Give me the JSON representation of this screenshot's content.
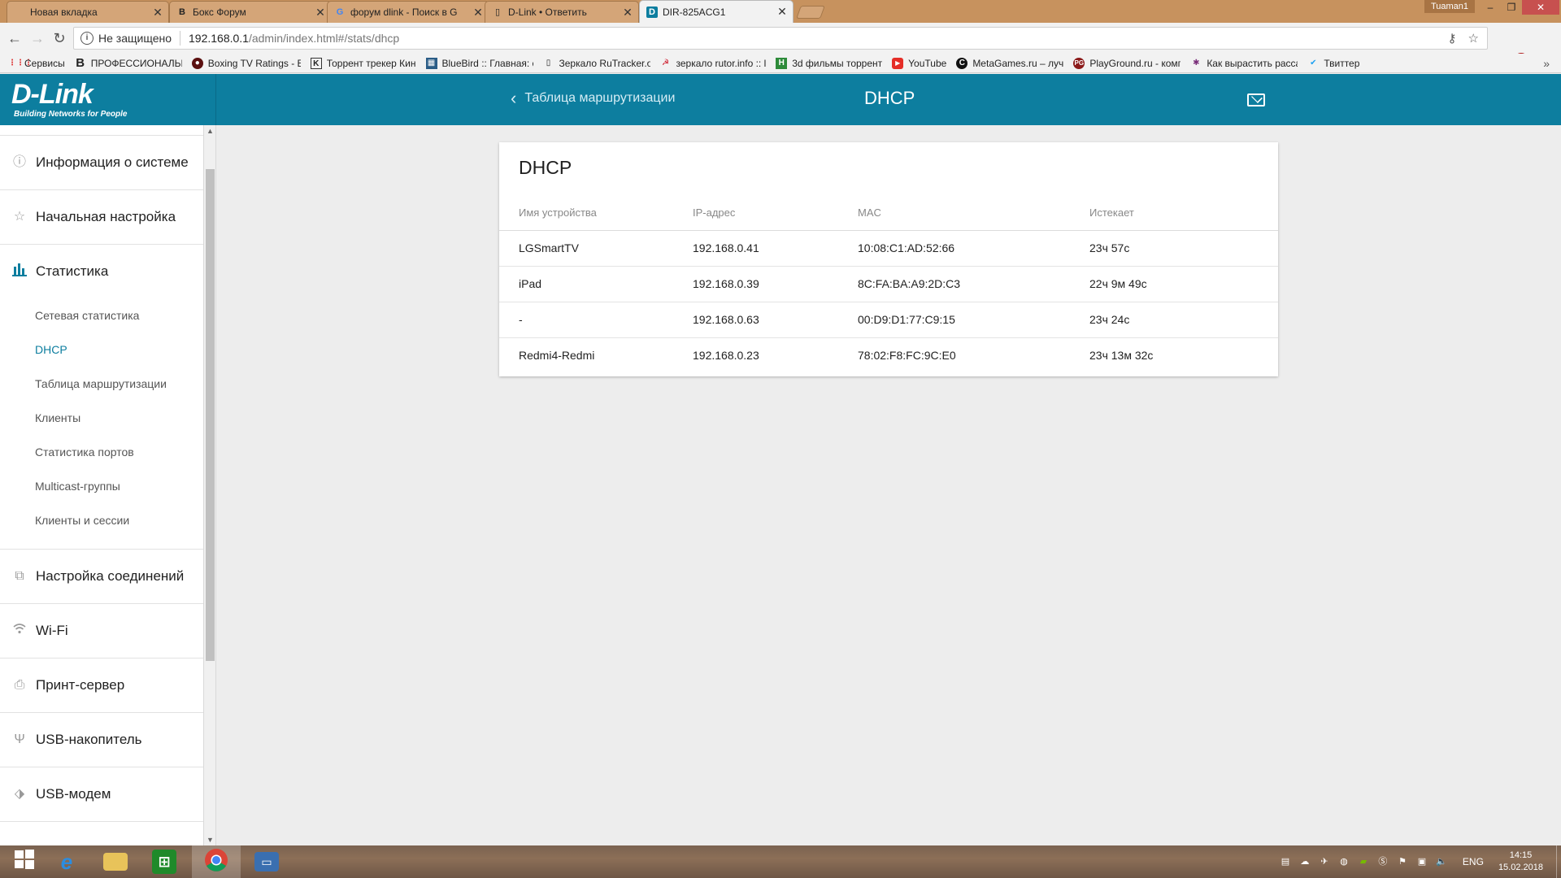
{
  "browser": {
    "tabs": [
      {
        "title": "Новая вкладка",
        "favicon": "blank-page-icon",
        "active": false
      },
      {
        "title": "Бокс Форум",
        "favicon": "vk-b-icon",
        "active": false
      },
      {
        "title": "форум dlink - Поиск в G",
        "favicon": "google-g-icon",
        "active": false
      },
      {
        "title": "D-Link • Ответить",
        "favicon": "page-icon",
        "active": false
      },
      {
        "title": "DIR-825ACG1",
        "favicon": "dlink-d-icon",
        "active": true
      }
    ],
    "user_badge": "Tuaman1",
    "security_label": "Не защищено",
    "url_host": "192.168.0.1",
    "url_path": "/admin/index.html#/stats/dhcp",
    "bookmarks": [
      {
        "label": "Сервисы",
        "icon": "apps-grid-icon"
      },
      {
        "label": "ПРОФЕССИОНАЛЬН",
        "icon": "b-logo-icon"
      },
      {
        "label": "Boxing TV Ratings - E",
        "icon": "boxing-icon"
      },
      {
        "label": "Торрент трекер Кин",
        "icon": "k-logo-icon"
      },
      {
        "label": "BlueBird :: Главная: с",
        "icon": "bluebird-icon"
      },
      {
        "label": "Зеркало RuTracker.o",
        "icon": "page-icon"
      },
      {
        "label": "зеркало rutor.info :: l",
        "icon": "rutor-icon"
      },
      {
        "label": "3d фильмы торрент",
        "icon": "h-logo-icon"
      },
      {
        "label": "YouTube",
        "icon": "youtube-icon"
      },
      {
        "label": "MetaGames.ru – лучш",
        "icon": "metagames-icon"
      },
      {
        "label": "PlayGround.ru - комп",
        "icon": "playground-icon"
      },
      {
        "label": "Как вырастить расса",
        "icon": "plant-icon"
      },
      {
        "label": "Твиттер",
        "icon": "twitter-icon"
      }
    ]
  },
  "app": {
    "logo_name": "D-Link",
    "logo_tagline": "Building Networks for People",
    "header": {
      "back_label": "Таблица маршрутизации",
      "title": "DHCP"
    },
    "sidebar": {
      "groups": [
        {
          "label": "Информация о системе",
          "icon": "info-icon",
          "active": false
        },
        {
          "label": "Начальная настройка",
          "icon": "star-icon",
          "active": false
        },
        {
          "label": "Статистика",
          "icon": "bar-chart-icon",
          "active": true,
          "items": [
            "Сетевая статистика",
            "DHCP",
            "Таблица маршрутизации",
            "Клиенты",
            "Статистика портов",
            "Multicast-группы",
            "Клиенты и сессии"
          ],
          "current": "DHCP"
        },
        {
          "label": "Настройка соединений",
          "icon": "connections-icon",
          "active": false
        },
        {
          "label": "Wi-Fi",
          "icon": "wifi-icon",
          "active": false
        },
        {
          "label": "Принт-сервер",
          "icon": "printer-icon",
          "active": false
        },
        {
          "label": "USB-накопитель",
          "icon": "usb-icon",
          "active": false
        },
        {
          "label": "USB-модем",
          "icon": "usb-modem-icon",
          "active": false
        }
      ]
    },
    "card": {
      "title": "DHCP",
      "columns": [
        "Имя устройства",
        "IP-адрес",
        "MAC",
        "Истекает"
      ],
      "rows": [
        [
          "LGSmartTV",
          "192.168.0.41",
          "10:08:C1:AD:52:66",
          "23ч 57с"
        ],
        [
          "iPad",
          "192.168.0.39",
          "8C:FA:BA:A9:2D:C3",
          "22ч 9м 49с"
        ],
        [
          "-",
          "192.168.0.63",
          "00:D9:D1:77:C9:15",
          "23ч 24с"
        ],
        [
          "Redmi4-Redmi",
          "192.168.0.23",
          "78:02:F8:FC:9C:E0",
          "23ч 13м 32с"
        ]
      ]
    }
  },
  "taskbar": {
    "language": "ENG",
    "time": "14:15",
    "date": "15.02.2018",
    "apps": [
      "start-icon",
      "internet-explorer-icon",
      "file-explorer-icon",
      "store-icon",
      "chrome-icon",
      "remote-desktop-icon"
    ]
  },
  "colors": {
    "brand": "#0d7e9f",
    "tabbar": "#c7925e",
    "content_bg": "#ededed"
  }
}
